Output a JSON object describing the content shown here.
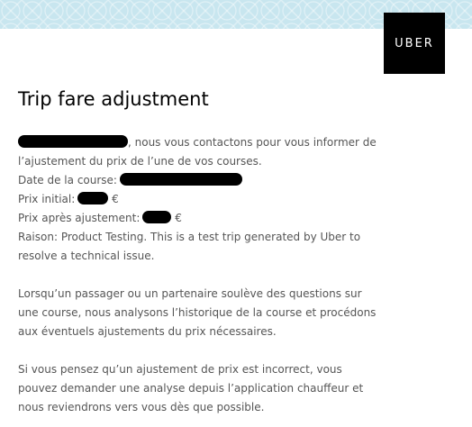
{
  "banner": {
    "color": "#c8e6ef"
  },
  "logo": {
    "text": "UBER"
  },
  "email": {
    "title": "Trip fare adjustment",
    "intro_line1": ", nous vous contactons pour vous informer de",
    "intro_line2": "l’ajustement du prix de l’une de vos courses.",
    "date_label": "Date de la course:",
    "initial_price_label": "Prix initial:",
    "currency": "€",
    "adjusted_price_label": "Prix après ajustement:",
    "reason_line1": "Raison: Product Testing. This is a test trip generated by Uber to",
    "reason_line2": "resolve a technical issue.",
    "paragraph2_line1": "Lorsqu’un passager ou un partenaire soulève des questions sur",
    "paragraph2_line2": "une course, nous analysons l’historique de la course et procédons",
    "paragraph2_line3": "aux éventuels ajustements du prix nécessaires.",
    "paragraph3_line1": "Si vous pensez qu’un ajustement de prix est incorrect, vous",
    "paragraph3_line2": "pouvez demander une analyse depuis l’application chauffeur et",
    "paragraph3_line3": "nous reviendrons vers vous dès que possible."
  }
}
